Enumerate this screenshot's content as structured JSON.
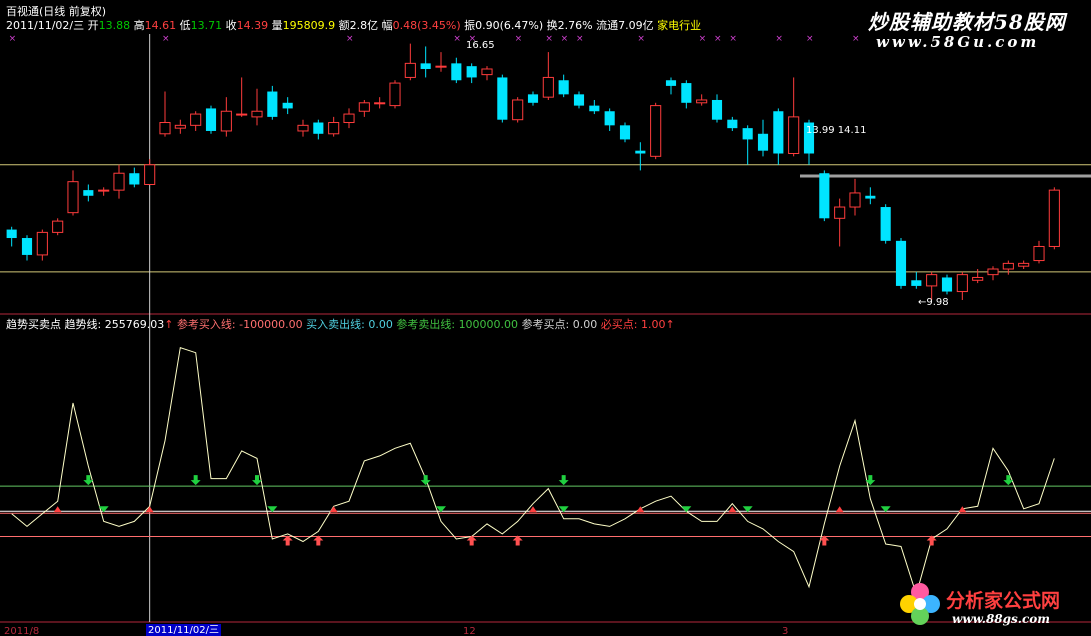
{
  "app": {
    "title": "百视通(日线 前复权)"
  },
  "quote": {
    "date": "2011/11/02/三",
    "open_label": "开",
    "open": "13.88",
    "high_label": "高",
    "high": "14.61",
    "low_label": "低",
    "low": "13.71",
    "close_label": "收",
    "close": "14.39",
    "volume_label": "量",
    "volume": "195809.9",
    "amount_label": "额",
    "amount": "2.8亿",
    "change_label": "幅",
    "change": "0.48(3.45%)",
    "amplitude_label": "振",
    "amplitude": "0.90(6.47%)",
    "turnover_label": "换",
    "turnover": "2.76%",
    "float_label": "流通",
    "float_cap": "7.09亿",
    "industry": "家电行业"
  },
  "price_annotations": {
    "high_mark": "16.65",
    "level_mark": "13.99 14.11",
    "low_mark": "←9.98"
  },
  "indicator": {
    "name": "趋势买卖点",
    "trend_label": "趋势线:",
    "trend_value": "255769.03",
    "ref_buy_label": "参考买入线:",
    "ref_buy_value": "-100000.00",
    "buysell_label": "买入卖出线:",
    "buysell_value": "0.00",
    "ref_sell_label": "参考卖出线:",
    "ref_sell_value": "100000.00",
    "ref_point_label": "参考买点:",
    "ref_point_value": "0.00",
    "must_buy_label": "必买点:",
    "must_buy_value": "1.00"
  },
  "date_axis": {
    "start": "2011/8",
    "cursor": "2011/11/02/三",
    "mid": "12",
    "right": "3"
  },
  "watermark": {
    "top": "炒股辅助教材58股网",
    "top_url": "www.58Gu.com",
    "bottom": "分析家公式网",
    "bottom_url": "www.88gs.com"
  },
  "colors": {
    "up": "#ff3c3c",
    "down": "#00e4ff",
    "trend_line": "#ffffc8",
    "ref_line_green": "#64c864",
    "ref_line_red": "#ff6e6e",
    "grid_yellow": "#d2c878",
    "separator": "#b4283c"
  },
  "chart_data": [
    {
      "type": "candlestick",
      "title": "百视通(日线 前复权)",
      "annotations": [
        "16.65",
        "13.99 14.11",
        "9.98"
      ],
      "candles": [
        {
          "o": 12.1,
          "c": 11.8,
          "h": 12.2,
          "l": 11.5
        },
        {
          "o": 11.8,
          "c": 11.2,
          "h": 11.9,
          "l": 11.0
        },
        {
          "o": 11.2,
          "c": 12.0,
          "h": 12.1,
          "l": 11.0
        },
        {
          "o": 12.0,
          "c": 12.4,
          "h": 12.5,
          "l": 11.9
        },
        {
          "o": 12.7,
          "c": 13.8,
          "h": 14.2,
          "l": 12.6
        },
        {
          "o": 13.5,
          "c": 13.3,
          "h": 13.7,
          "l": 13.1
        },
        {
          "o": 13.5,
          "c": 13.5,
          "h": 13.6,
          "l": 13.3
        },
        {
          "o": 13.5,
          "c": 14.1,
          "h": 14.4,
          "l": 13.2
        },
        {
          "o": 14.1,
          "c": 13.7,
          "h": 14.3,
          "l": 13.6
        },
        {
          "o": 13.7,
          "c": 14.4,
          "h": 14.6,
          "l": 13.7
        },
        {
          "o": 15.5,
          "c": 15.9,
          "h": 17.0,
          "l": 15.4
        },
        {
          "o": 15.7,
          "c": 15.8,
          "h": 16.0,
          "l": 15.5
        },
        {
          "o": 15.8,
          "c": 16.2,
          "h": 16.3,
          "l": 15.6
        },
        {
          "o": 16.4,
          "c": 15.6,
          "h": 16.5,
          "l": 15.5
        },
        {
          "o": 15.6,
          "c": 16.3,
          "h": 16.8,
          "l": 15.4
        },
        {
          "o": 16.2,
          "c": 16.2,
          "h": 17.5,
          "l": 16.1
        },
        {
          "o": 16.1,
          "c": 16.3,
          "h": 17.1,
          "l": 15.8
        },
        {
          "o": 17.0,
          "c": 16.1,
          "h": 17.2,
          "l": 16.0
        },
        {
          "o": 16.6,
          "c": 16.4,
          "h": 16.8,
          "l": 16.2
        },
        {
          "o": 15.6,
          "c": 15.8,
          "h": 16.0,
          "l": 15.4
        },
        {
          "o": 15.9,
          "c": 15.5,
          "h": 16.0,
          "l": 15.3
        },
        {
          "o": 15.5,
          "c": 15.9,
          "h": 16.1,
          "l": 15.4
        },
        {
          "o": 15.9,
          "c": 16.2,
          "h": 16.4,
          "l": 15.7
        },
        {
          "o": 16.3,
          "c": 16.6,
          "h": 16.7,
          "l": 16.1
        },
        {
          "o": 16.6,
          "c": 16.6,
          "h": 16.8,
          "l": 16.4
        },
        {
          "o": 16.5,
          "c": 17.3,
          "h": 17.4,
          "l": 16.4
        },
        {
          "o": 17.5,
          "c": 18.0,
          "h": 18.7,
          "l": 17.4
        },
        {
          "o": 18.0,
          "c": 17.8,
          "h": 18.6,
          "l": 17.5
        },
        {
          "o": 17.9,
          "c": 17.9,
          "h": 18.4,
          "l": 17.7
        },
        {
          "o": 18.0,
          "c": 17.4,
          "h": 18.2,
          "l": 17.3
        },
        {
          "o": 17.9,
          "c": 17.5,
          "h": 18.0,
          "l": 17.3
        },
        {
          "o": 17.6,
          "c": 17.8,
          "h": 17.9,
          "l": 17.4
        },
        {
          "o": 17.5,
          "c": 16.0,
          "h": 17.6,
          "l": 15.9
        },
        {
          "o": 16.0,
          "c": 16.7,
          "h": 16.8,
          "l": 15.9
        },
        {
          "o": 16.9,
          "c": 16.6,
          "h": 17.0,
          "l": 16.5
        },
        {
          "o": 16.8,
          "c": 17.5,
          "h": 18.4,
          "l": 16.7
        },
        {
          "o": 17.4,
          "c": 16.9,
          "h": 17.6,
          "l": 16.8
        },
        {
          "o": 16.9,
          "c": 16.5,
          "h": 17.0,
          "l": 16.4
        },
        {
          "o": 16.5,
          "c": 16.3,
          "h": 16.7,
          "l": 16.2
        },
        {
          "o": 16.3,
          "c": 15.8,
          "h": 16.4,
          "l": 15.6
        },
        {
          "o": 15.8,
          "c": 15.3,
          "h": 15.9,
          "l": 15.2
        },
        {
          "o": 14.9,
          "c": 14.8,
          "h": 15.2,
          "l": 14.2
        },
        {
          "o": 14.7,
          "c": 16.5,
          "h": 16.6,
          "l": 14.6
        },
        {
          "o": 17.4,
          "c": 17.2,
          "h": 17.5,
          "l": 16.9
        },
        {
          "o": 17.3,
          "c": 16.6,
          "h": 17.4,
          "l": 16.4
        },
        {
          "o": 16.6,
          "c": 16.7,
          "h": 16.9,
          "l": 16.5
        },
        {
          "o": 16.7,
          "c": 16.0,
          "h": 16.9,
          "l": 15.9
        },
        {
          "o": 16.0,
          "c": 15.7,
          "h": 16.1,
          "l": 15.6
        },
        {
          "o": 15.7,
          "c": 15.3,
          "h": 15.8,
          "l": 14.4
        },
        {
          "o": 15.5,
          "c": 14.9,
          "h": 16.0,
          "l": 14.7
        },
        {
          "o": 16.3,
          "c": 14.8,
          "h": 16.4,
          "l": 14.4
        },
        {
          "o": 14.8,
          "c": 16.1,
          "h": 17.5,
          "l": 14.7
        },
        {
          "o": 15.9,
          "c": 14.8,
          "h": 16.0,
          "l": 14.4
        },
        {
          "o": 14.1,
          "c": 12.5,
          "h": 14.2,
          "l": 12.4
        },
        {
          "o": 12.5,
          "c": 12.9,
          "h": 13.2,
          "l": 11.5
        },
        {
          "o": 12.9,
          "c": 13.4,
          "h": 13.9,
          "l": 12.6
        },
        {
          "o": 13.3,
          "c": 13.2,
          "h": 13.6,
          "l": 13.0
        },
        {
          "o": 12.9,
          "c": 11.7,
          "h": 13.0,
          "l": 11.6
        },
        {
          "o": 11.7,
          "c": 10.1,
          "h": 11.8,
          "l": 10.0
        },
        {
          "o": 10.3,
          "c": 10.1,
          "h": 10.6,
          "l": 10.0
        },
        {
          "o": 10.1,
          "c": 10.5,
          "h": 10.6,
          "l": 9.6
        },
        {
          "o": 10.4,
          "c": 9.9,
          "h": 10.5,
          "l": 9.8
        },
        {
          "o": 9.9,
          "c": 10.5,
          "h": 10.6,
          "l": 9.6
        },
        {
          "o": 10.3,
          "c": 10.4,
          "h": 10.7,
          "l": 10.2
        },
        {
          "o": 10.5,
          "c": 10.7,
          "h": 10.8,
          "l": 10.3
        },
        {
          "o": 10.7,
          "c": 10.9,
          "h": 11.0,
          "l": 10.5
        },
        {
          "o": 10.8,
          "c": 10.9,
          "h": 11.0,
          "l": 10.7
        },
        {
          "o": 11.0,
          "c": 11.5,
          "h": 11.7,
          "l": 10.9
        },
        {
          "o": 11.5,
          "c": 13.5,
          "h": 13.6,
          "l": 11.4
        }
      ],
      "hlines": [
        14.4,
        10.6
      ],
      "cursor_index": 9
    },
    {
      "type": "line",
      "title": "趋势买卖点",
      "series": [
        {
          "name": "趋势线",
          "values": [
            -0.1,
            -0.6,
            -0.1,
            0.4,
            4.3,
            1.8,
            -0.4,
            -0.6,
            -0.4,
            0.2,
            2.8,
            6.5,
            6.3,
            1.3,
            1.3,
            2.4,
            2.1,
            -1.1,
            -0.9,
            -1.2,
            -0.8,
            0.2,
            0.4,
            2.0,
            2.2,
            2.5,
            2.7,
            1.3,
            -0.4,
            -1.1,
            -1.0,
            -0.5,
            -0.9,
            -0.4,
            0.3,
            0.9,
            -0.3,
            -0.3,
            -0.5,
            -0.6,
            -0.3,
            0.1,
            0.4,
            0.6,
            0.0,
            -0.4,
            -0.4,
            0.3,
            -0.4,
            -0.7,
            -1.2,
            -1.6,
            -3.0,
            -0.5,
            1.8,
            3.6,
            0.5,
            -1.3,
            -1.4,
            -3.3,
            -1.1,
            -0.7,
            0.1,
            0.2,
            2.5,
            1.6,
            0.1,
            0.3,
            2.1
          ]
        }
      ],
      "reference_lines": [
        {
          "name": "参考卖出线",
          "value": 1.0
        },
        {
          "name": "买入卖出线",
          "value": 0.0
        },
        {
          "name": "参考买入线",
          "value": -1.0
        }
      ],
      "ylim": [
        -4.0,
        7.2
      ]
    }
  ]
}
